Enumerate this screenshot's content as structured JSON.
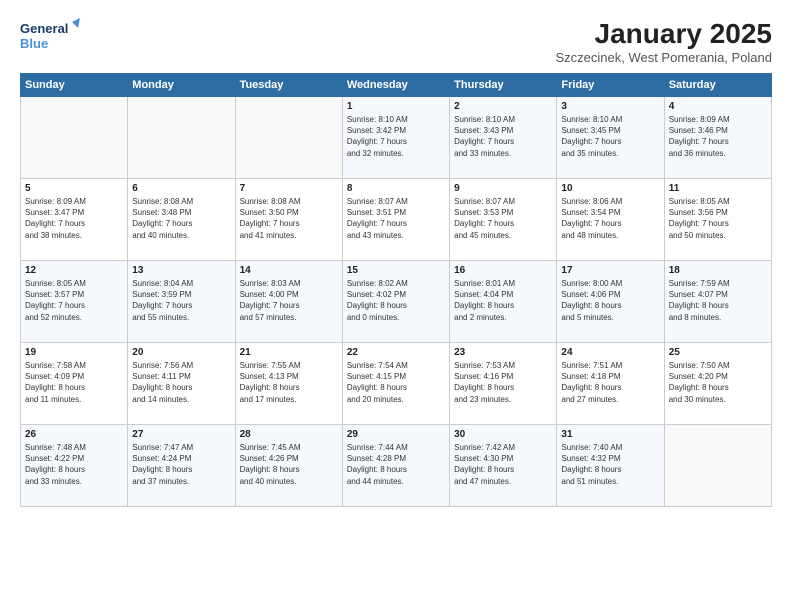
{
  "logo": {
    "line1": "General",
    "line2": "Blue"
  },
  "title": "January 2025",
  "subtitle": "Szczecinek, West Pomerania, Poland",
  "days_of_week": [
    "Sunday",
    "Monday",
    "Tuesday",
    "Wednesday",
    "Thursday",
    "Friday",
    "Saturday"
  ],
  "weeks": [
    [
      {
        "day": "",
        "info": ""
      },
      {
        "day": "",
        "info": ""
      },
      {
        "day": "",
        "info": ""
      },
      {
        "day": "1",
        "info": "Sunrise: 8:10 AM\nSunset: 3:42 PM\nDaylight: 7 hours\nand 32 minutes."
      },
      {
        "day": "2",
        "info": "Sunrise: 8:10 AM\nSunset: 3:43 PM\nDaylight: 7 hours\nand 33 minutes."
      },
      {
        "day": "3",
        "info": "Sunrise: 8:10 AM\nSunset: 3:45 PM\nDaylight: 7 hours\nand 35 minutes."
      },
      {
        "day": "4",
        "info": "Sunrise: 8:09 AM\nSunset: 3:46 PM\nDaylight: 7 hours\nand 36 minutes."
      }
    ],
    [
      {
        "day": "5",
        "info": "Sunrise: 8:09 AM\nSunset: 3:47 PM\nDaylight: 7 hours\nand 38 minutes."
      },
      {
        "day": "6",
        "info": "Sunrise: 8:08 AM\nSunset: 3:48 PM\nDaylight: 7 hours\nand 40 minutes."
      },
      {
        "day": "7",
        "info": "Sunrise: 8:08 AM\nSunset: 3:50 PM\nDaylight: 7 hours\nand 41 minutes."
      },
      {
        "day": "8",
        "info": "Sunrise: 8:07 AM\nSunset: 3:51 PM\nDaylight: 7 hours\nand 43 minutes."
      },
      {
        "day": "9",
        "info": "Sunrise: 8:07 AM\nSunset: 3:53 PM\nDaylight: 7 hours\nand 45 minutes."
      },
      {
        "day": "10",
        "info": "Sunrise: 8:06 AM\nSunset: 3:54 PM\nDaylight: 7 hours\nand 48 minutes."
      },
      {
        "day": "11",
        "info": "Sunrise: 8:05 AM\nSunset: 3:56 PM\nDaylight: 7 hours\nand 50 minutes."
      }
    ],
    [
      {
        "day": "12",
        "info": "Sunrise: 8:05 AM\nSunset: 3:57 PM\nDaylight: 7 hours\nand 52 minutes."
      },
      {
        "day": "13",
        "info": "Sunrise: 8:04 AM\nSunset: 3:59 PM\nDaylight: 7 hours\nand 55 minutes."
      },
      {
        "day": "14",
        "info": "Sunrise: 8:03 AM\nSunset: 4:00 PM\nDaylight: 7 hours\nand 57 minutes."
      },
      {
        "day": "15",
        "info": "Sunrise: 8:02 AM\nSunset: 4:02 PM\nDaylight: 8 hours\nand 0 minutes."
      },
      {
        "day": "16",
        "info": "Sunrise: 8:01 AM\nSunset: 4:04 PM\nDaylight: 8 hours\nand 2 minutes."
      },
      {
        "day": "17",
        "info": "Sunrise: 8:00 AM\nSunset: 4:06 PM\nDaylight: 8 hours\nand 5 minutes."
      },
      {
        "day": "18",
        "info": "Sunrise: 7:59 AM\nSunset: 4:07 PM\nDaylight: 8 hours\nand 8 minutes."
      }
    ],
    [
      {
        "day": "19",
        "info": "Sunrise: 7:58 AM\nSunset: 4:09 PM\nDaylight: 8 hours\nand 11 minutes."
      },
      {
        "day": "20",
        "info": "Sunrise: 7:56 AM\nSunset: 4:11 PM\nDaylight: 8 hours\nand 14 minutes."
      },
      {
        "day": "21",
        "info": "Sunrise: 7:55 AM\nSunset: 4:13 PM\nDaylight: 8 hours\nand 17 minutes."
      },
      {
        "day": "22",
        "info": "Sunrise: 7:54 AM\nSunset: 4:15 PM\nDaylight: 8 hours\nand 20 minutes."
      },
      {
        "day": "23",
        "info": "Sunrise: 7:53 AM\nSunset: 4:16 PM\nDaylight: 8 hours\nand 23 minutes."
      },
      {
        "day": "24",
        "info": "Sunrise: 7:51 AM\nSunset: 4:18 PM\nDaylight: 8 hours\nand 27 minutes."
      },
      {
        "day": "25",
        "info": "Sunrise: 7:50 AM\nSunset: 4:20 PM\nDaylight: 8 hours\nand 30 minutes."
      }
    ],
    [
      {
        "day": "26",
        "info": "Sunrise: 7:48 AM\nSunset: 4:22 PM\nDaylight: 8 hours\nand 33 minutes."
      },
      {
        "day": "27",
        "info": "Sunrise: 7:47 AM\nSunset: 4:24 PM\nDaylight: 8 hours\nand 37 minutes."
      },
      {
        "day": "28",
        "info": "Sunrise: 7:45 AM\nSunset: 4:26 PM\nDaylight: 8 hours\nand 40 minutes."
      },
      {
        "day": "29",
        "info": "Sunrise: 7:44 AM\nSunset: 4:28 PM\nDaylight: 8 hours\nand 44 minutes."
      },
      {
        "day": "30",
        "info": "Sunrise: 7:42 AM\nSunset: 4:30 PM\nDaylight: 8 hours\nand 47 minutes."
      },
      {
        "day": "31",
        "info": "Sunrise: 7:40 AM\nSunset: 4:32 PM\nDaylight: 8 hours\nand 51 minutes."
      },
      {
        "day": "",
        "info": ""
      }
    ]
  ]
}
